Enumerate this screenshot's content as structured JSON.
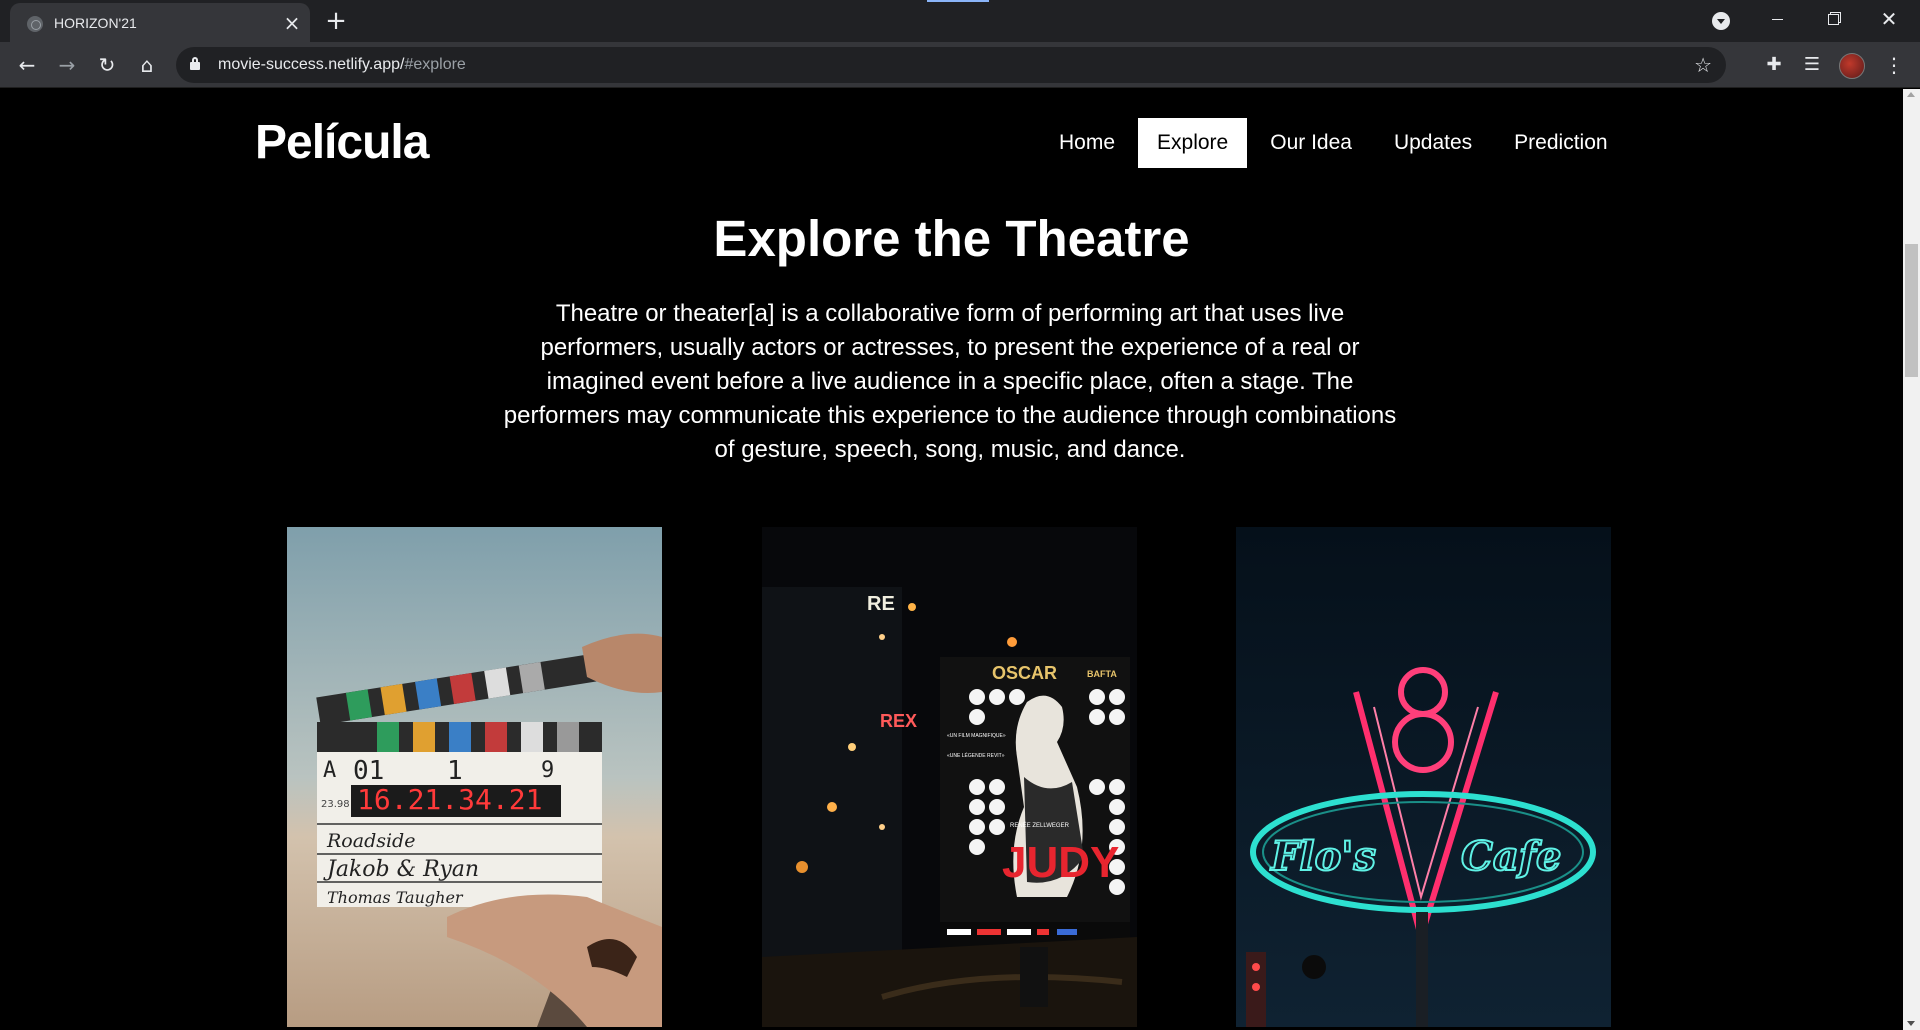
{
  "browser": {
    "tab_title": "HORIZON'21",
    "tab_close": "×",
    "new_tab": "+",
    "url_host": "movie-success.netlify.app/",
    "url_path": "#explore",
    "window_min": "",
    "window_max": "",
    "window_close": "✕"
  },
  "site": {
    "logo": "Película",
    "nav": [
      {
        "label": "Home",
        "active": false
      },
      {
        "label": "Explore",
        "active": true
      },
      {
        "label": "Our Idea",
        "active": false
      },
      {
        "label": "Updates",
        "active": false
      },
      {
        "label": "Prediction",
        "active": false
      }
    ],
    "hero": {
      "title": "Explore the Theatre",
      "text": "Theatre or theater[a] is a collaborative form of performing art that uses live performers, usually actors or actresses, to present the experience of a real or imagined event before a live audience in a specific place, often a stage. The performers may communicate this experience to the audience through combinations of gesture, speech, song, music, and dance."
    },
    "gallery": {
      "clapper": {
        "row1": [
          "A",
          "01",
          "1",
          "9"
        ],
        "timecode": "16.21.34.21",
        "fps": "23.98",
        "line1": "Roadside",
        "line2": "Jakob & Ryan",
        "line3": "Thomas Taugher"
      },
      "poster": {
        "award1": "OSCAR",
        "award2": "BAFTA",
        "star": "RENÉE ZELLWEGER",
        "title": "JUDY",
        "quote1": "«UN FILM MAGNIFIQUE»",
        "quote2": "«UNE LÉGENDE REVIT»",
        "sign": "REX"
      },
      "neon": {
        "number": "8",
        "left": "Flo's",
        "right": "Cafe"
      }
    }
  }
}
